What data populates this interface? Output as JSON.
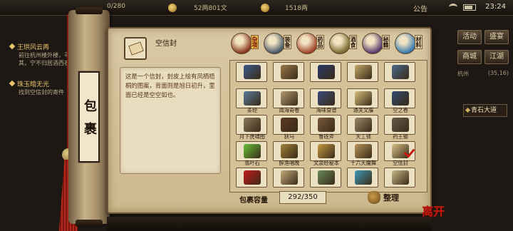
{
  "hud": {
    "silver_partial": "0/280",
    "money": "52两801文",
    "gold": "1518两",
    "announce": "公告",
    "time": "23:24"
  },
  "quests": [
    {
      "title": "王珙风云再",
      "desc": "前往杭州楼外楼，寻找其，宁不归居酒西石"
    },
    {
      "title": "珠玉暗无光",
      "desc": "找到空信封的寄件"
    }
  ],
  "right_menu": {
    "buttons": [
      "活动",
      "盛宴",
      "商城",
      "江湖"
    ],
    "location": "杭州",
    "coords": "(35,16)",
    "current_place": "青石大道"
  },
  "scroll": {
    "title": "包裹",
    "selected_item": {
      "name": "空信封",
      "description": "这是一个信封，封皮上绘有凤栖梧桐的图案，背面则是旭日初升，里面已经是空空如也。"
    }
  },
  "categories": [
    {
      "label": "杂项",
      "active": true,
      "color": "#8a3a22"
    },
    {
      "label": "装备",
      "active": false,
      "color": "#4a5a6a"
    },
    {
      "label": "药品",
      "active": false,
      "color": "#a2462c"
    },
    {
      "label": "酒食",
      "active": false,
      "color": "#7a6a30"
    },
    {
      "label": "秘籍",
      "active": false,
      "color": "#5a3b6e"
    },
    {
      "label": "材料",
      "active": false,
      "color": "#3a7ab0"
    }
  ],
  "items": [
    {
      "name": "",
      "color": "#3a5a8a",
      "checked": false
    },
    {
      "name": "",
      "color": "#9a7a4a",
      "checked": false
    },
    {
      "name": "",
      "color": "#2a3a6a",
      "checked": false
    },
    {
      "name": "",
      "color": "#c2a86a",
      "checked": false
    },
    {
      "name": "",
      "color": "#4a6a8a",
      "checked": false
    },
    {
      "name": "茶经",
      "color": "#5a7a9a",
      "checked": false
    },
    {
      "name": "闻海奇卷",
      "color": "#b09a70",
      "checked": false
    },
    {
      "name": "海味食谱",
      "color": "#3a4a7a",
      "checked": false
    },
    {
      "name": "通关文牒",
      "color": "#d6bd7a",
      "checked": false
    },
    {
      "name": "空之卷",
      "color": "#2e4a6e",
      "checked": false
    },
    {
      "name": "月下虎啸图",
      "color": "#8a7a5a",
      "checked": false
    },
    {
      "name": "狄马",
      "color": "#5a3a22",
      "checked": false
    },
    {
      "name": "鲁班斧",
      "color": "#7a5a3a",
      "checked": false
    },
    {
      "name": "天工锁",
      "color": "#9a8a6a",
      "checked": false
    },
    {
      "name": "药王锄",
      "color": "#6a5a4a",
      "checked": false
    },
    {
      "name": "翡叶石",
      "color": "#6ac23a",
      "checked": false
    },
    {
      "name": "醉渔唱晚",
      "color": "#a0823a",
      "checked": false
    },
    {
      "name": "文泉经秘本",
      "color": "#c49a42",
      "checked": false
    },
    {
      "name": "十六天魔舞",
      "color": "#b8945a",
      "checked": false
    },
    {
      "name": "空信封",
      "color": "#d8c28a",
      "checked": true
    },
    {
      "name": "",
      "color": "#c21a1a",
      "checked": false
    },
    {
      "name": "",
      "color": "#c2aa7a",
      "checked": false
    },
    {
      "name": "",
      "color": "#6a8a5a",
      "checked": false
    },
    {
      "name": "",
      "color": "#3a9ab8",
      "checked": false
    },
    {
      "name": "",
      "color": "#c8b88a",
      "checked": false
    }
  ],
  "capacity": {
    "label": "包裹容量",
    "value": "292/350"
  },
  "sort_label": "整理",
  "seal": "离开"
}
